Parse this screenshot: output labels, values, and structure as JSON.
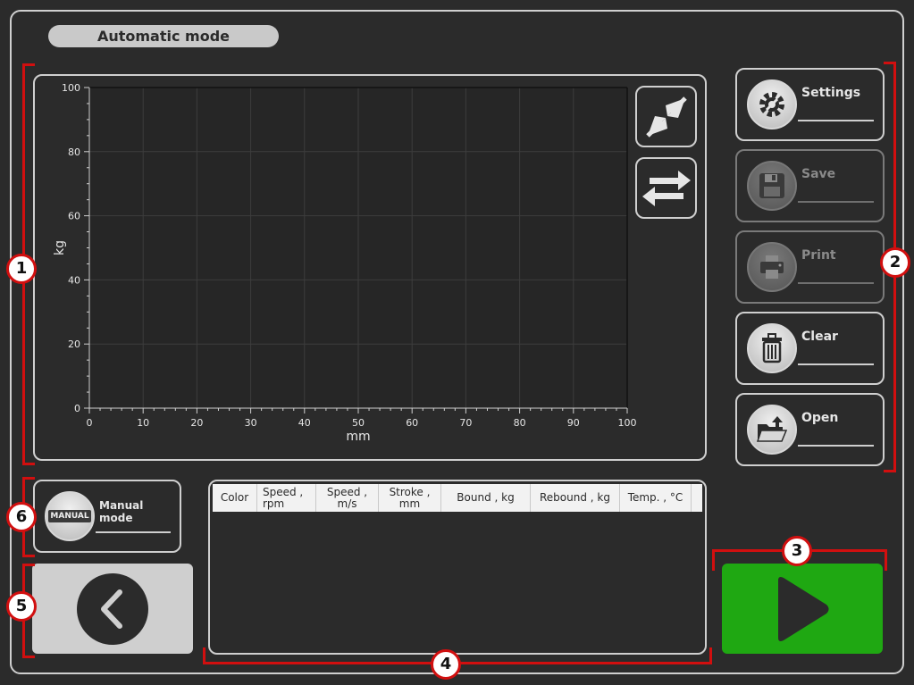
{
  "header": {
    "title": "Automatic mode"
  },
  "chart_data": {
    "type": "line",
    "title": "",
    "xlabel": "mm",
    "ylabel": "kg",
    "xlim": [
      0,
      100
    ],
    "ylim": [
      0,
      100
    ],
    "x_ticks": [
      "0",
      "10",
      "20",
      "30",
      "40",
      "50",
      "60",
      "70",
      "80",
      "90",
      "100"
    ],
    "y_ticks": [
      "0",
      "20",
      "40",
      "60",
      "80",
      "100"
    ],
    "grid": true,
    "series": []
  },
  "chart_tools": {
    "zoom_icon": "collapse-arrows-icon",
    "pan_icon": "swap-arrows-icon"
  },
  "side_buttons": [
    {
      "label": "Settings",
      "icon": "gear-icon",
      "enabled": true
    },
    {
      "label": "Save",
      "icon": "floppy-disk-icon",
      "enabled": false
    },
    {
      "label": "Print",
      "icon": "printer-icon",
      "enabled": false
    },
    {
      "label": "Clear",
      "icon": "trash-icon",
      "enabled": true
    },
    {
      "label": "Open",
      "icon": "folder-open-icon",
      "enabled": true
    }
  ],
  "manual": {
    "label": "Manual mode",
    "badge": "MANUAL"
  },
  "table": {
    "columns": [
      "Color",
      "Speed ,\nrpm",
      "Speed , m/s",
      "Stroke , mm",
      "Bound , kg",
      "Rebound , kg",
      "Temp. , °C"
    ],
    "rows": []
  },
  "markers": [
    "1",
    "2",
    "3",
    "4",
    "5",
    "6"
  ],
  "colors": {
    "accent": "#d10f0f",
    "play": "#1fa812",
    "background": "#2b2b2b"
  }
}
